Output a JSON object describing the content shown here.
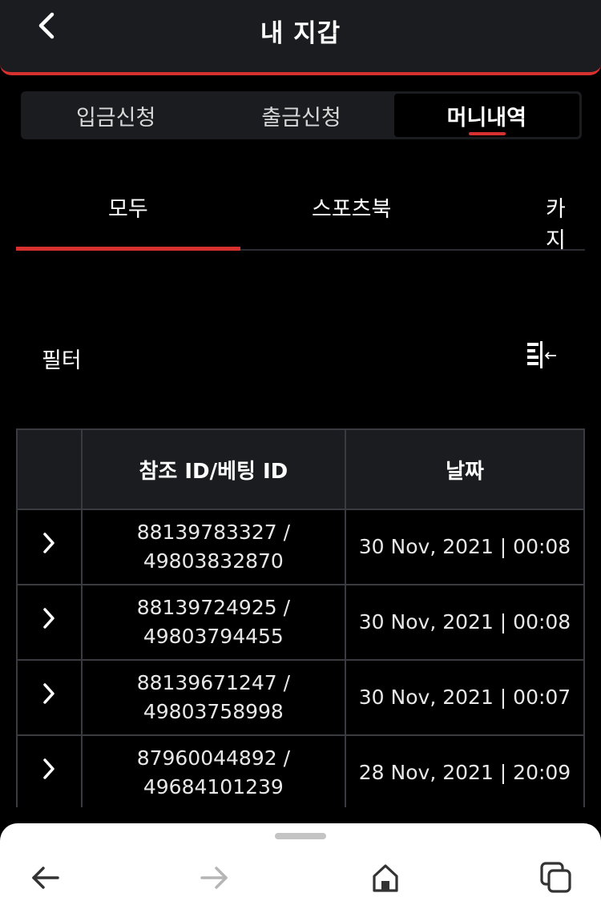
{
  "header": {
    "title": "내 지갑",
    "back_icon": "chevron-left-icon"
  },
  "segmented_tabs": [
    {
      "label": "입금신청",
      "active": false
    },
    {
      "label": "출금신청",
      "active": false
    },
    {
      "label": "머니내역",
      "active": true
    }
  ],
  "category_tabs": [
    {
      "label": "모두",
      "active": true
    },
    {
      "label": "스포츠북",
      "active": false
    },
    {
      "label": "카지",
      "active": false
    }
  ],
  "filter": {
    "label": "필터",
    "icon": "filter-sort-icon"
  },
  "table": {
    "headers": [
      "",
      "참조 ID/베팅 ID",
      "날짜"
    ],
    "rows": [
      {
        "ref_id": "88139783327 /",
        "bet_id": "49803832870",
        "date": "30 Nov, 2021 | 00:08"
      },
      {
        "ref_id": "88139724925 /",
        "bet_id": "49803794455",
        "date": "30 Nov, 2021 | 00:08"
      },
      {
        "ref_id": "88139671247 /",
        "bet_id": "49803758998",
        "date": "30 Nov, 2021 | 00:07"
      },
      {
        "ref_id": "87960044892 /",
        "bet_id": "49684101239",
        "date": "28 Nov, 2021 | 20:09"
      }
    ]
  },
  "browser_bar": {
    "icons": [
      "back-arrow-icon",
      "forward-arrow-icon",
      "home-icon",
      "tabs-icon"
    ]
  },
  "colors": {
    "accent": "#d6302f",
    "panel": "#1b1c20",
    "background": "#000000"
  }
}
